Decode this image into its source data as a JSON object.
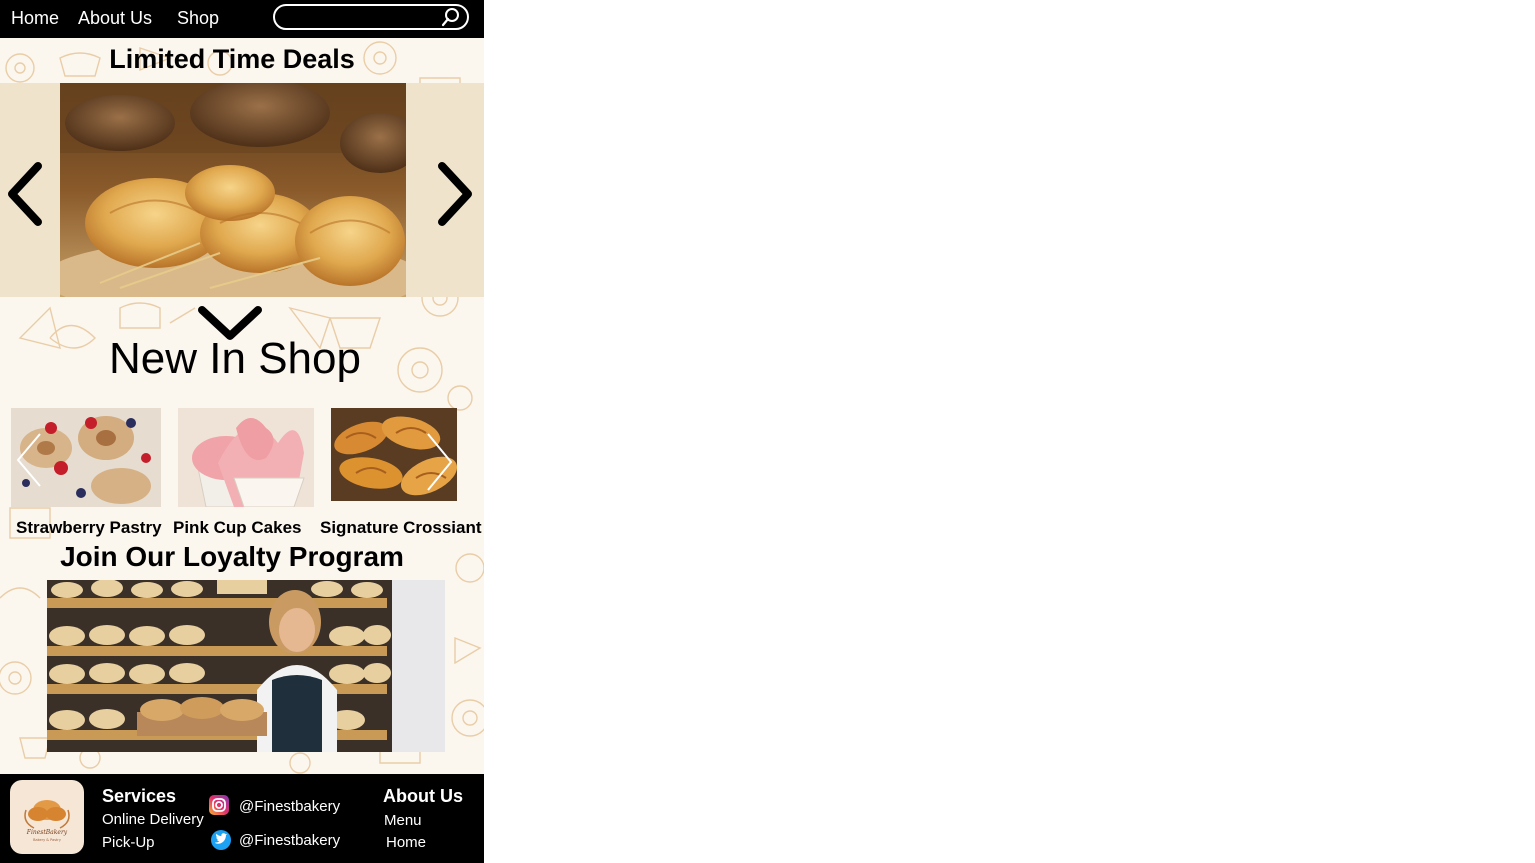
{
  "nav": {
    "home": "Home",
    "about": "About Us",
    "shop": "Shop"
  },
  "search": {
    "placeholder": "",
    "icon": "search-icon"
  },
  "deals": {
    "title": "Limited Time Deals"
  },
  "new_in_shop": {
    "title": "New In Shop",
    "products": [
      {
        "name": "Strawberry Pastry"
      },
      {
        "name": "Pink Cup Cakes"
      },
      {
        "name": "Signature Crossiant"
      }
    ]
  },
  "loyalty": {
    "title": "Join Our Loyalty Program"
  },
  "footer": {
    "services_heading": "Services",
    "services": [
      "Online Delivery",
      "Pick-Up"
    ],
    "instagram_handle": "@Finestbakery",
    "twitter_handle": "@Finestbakery",
    "about_heading": "About Us",
    "about_links": [
      "Menu",
      "Home"
    ],
    "logo_text": "FinestBakery",
    "logo_subtext": "Bakery & Pastry"
  },
  "colors": {
    "nav_bg": "#000000",
    "pattern_line": "#e8c9a0",
    "page_bg": "#fbf6ee",
    "footer_bg": "#000000"
  }
}
